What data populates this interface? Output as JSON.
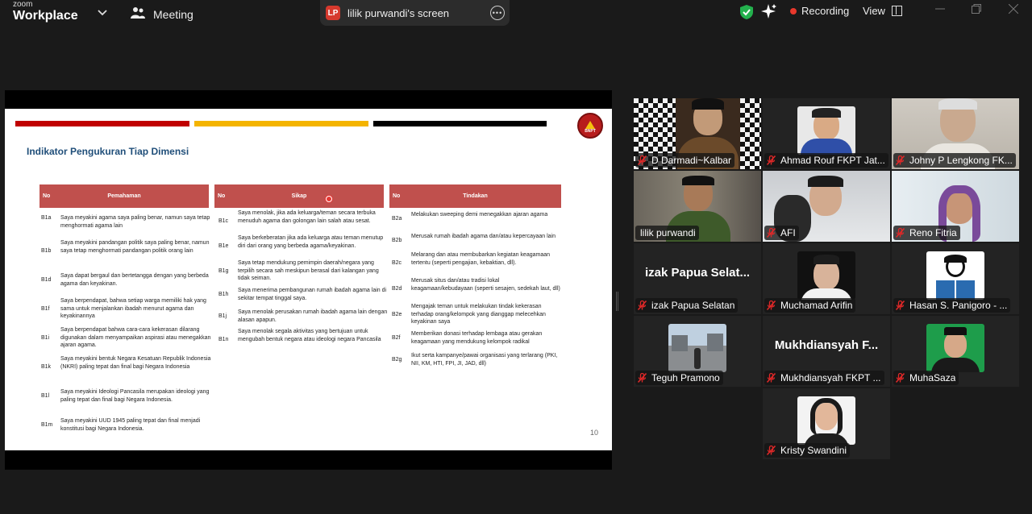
{
  "app": {
    "brand_top": "zoom",
    "brand_name": "Workplace",
    "meeting_label": "Meeting",
    "share_initials": "LP",
    "share_title": "lilik purwandi's screen",
    "recording_label": "Recording",
    "view_label": "View",
    "icons": [
      "chevron-down-icon",
      "people-icon",
      "more-icon",
      "shield-check-icon",
      "sparkle-icon",
      "view-grid-icon",
      "minimize-icon",
      "restore-icon",
      "close-icon"
    ]
  },
  "slide": {
    "title": "Indikator Pengukuran Tiap Dimensi",
    "logo_text": "BNPT",
    "page_number": "10",
    "colors": {
      "stripe1": "#c00000",
      "stripe2": "#f4b400",
      "stripe3": "#000000",
      "header": "#c0504d",
      "title": "#1f4e79"
    },
    "columns": [
      {
        "no_label": "No",
        "heading": "Pemahaman",
        "rows": [
          {
            "code": "B1a",
            "text": "Saya meyakini agama saya paling benar, namun saya tetap menghormati agama lain"
          },
          {
            "code": "B1b",
            "text": "Saya meyakini pandangan politik saya paling benar, namun saya tetap menghormati pandangan politik orang lain"
          },
          {
            "code": "B1d",
            "text": "Saya dapat bergaul dan bertetangga dengan yang berbeda agama dan keyakinan."
          },
          {
            "code": "B1f",
            "text": "Saya berpendapat, bahwa setiap warga memiliki hak yang sama untuk menjalankan ibadah menurut agama dan keyakinannya"
          },
          {
            "code": "B1i",
            "text": "Saya berpendapat bahwa cara-cara kekerasan dilarang digunakan dalam menyampaikan aspirasi atau menegakkan ajaran agama."
          },
          {
            "code": "B1k",
            "text": "Saya meyakini bentuk Negara Kesatuan Republik Indonesia (NKRI) paling tepat dan final bagi Negara Indonesia"
          },
          {
            "code": "B1l",
            "text": "Saya meyakini Ideologi Pancasila merupakan ideologi yang paling tepat dan final bagi Negara Indonesia."
          },
          {
            "code": "B1m",
            "text": "Saya meyakini UUD 1945 paling tepat dan final menjadi konstitusi bagi Negara Indonesia."
          }
        ]
      },
      {
        "no_label": "No",
        "heading": "Sikap",
        "rows": [
          {
            "code": "B1c",
            "text": "Saya menolak, jika ada keluarga/teman secara terbuka menuduh agama dan golongan lain salah atau sesat."
          },
          {
            "code": "B1e",
            "text": "Saya berkeberatan jika ada keluarga atau teman menutup diri dari orang yang berbeda agama/keyakinan."
          },
          {
            "code": "B1g",
            "text": "Saya tetap mendukung pemimpin daerah/negara yang terpilih secara sah meskipun berasal dari kalangan yang tidak seiman."
          },
          {
            "code": "B1h",
            "text": "Saya menerima pembangunan rumah ibadah agama lain di sekitar tempat tinggal saya."
          },
          {
            "code": "B1j",
            "text": "Saya menolak perusakan rumah ibadah agama lain dengan alasan apapun."
          },
          {
            "code": "B1n",
            "text": "Saya menolak segala aktivitas yang bertujuan untuk mengubah bentuk negara atau ideologi negara Pancasila"
          }
        ]
      },
      {
        "no_label": "No",
        "heading": "Tindakan",
        "rows": [
          {
            "code": "B2a",
            "text": "Melakukan sweeping demi menegakkan ajaran agama"
          },
          {
            "code": "B2b",
            "text": "Merusak rumah ibadah agama dan/atau kepercayaan lain"
          },
          {
            "code": "B2c",
            "text": "Melarang dan atau membubarkan kegiatan keagamaan tertentu (seperti pengajian, kebaktian, dll)."
          },
          {
            "code": "B2d",
            "text": "Merusak situs dan/atau tradisi lokal keagamaan/kebudayaan (seperti sesajen, sedekah laut, dll)"
          },
          {
            "code": "B2e",
            "text": "Mengajak teman untuk melakukan tindak kekerasan terhadap orang/kelompok yang dianggap melecehkan keyakinan saya"
          },
          {
            "code": "B2f",
            "text": "Memberikan donasi terhadap lembaga atau gerakan keagamaan yang mendukung kelompok radikal"
          },
          {
            "code": "B2g",
            "text": "Ikut serta kampanye/pawai organisasi yang terlarang (PKI, NII, KM, HTI, FPI, JI, JAD, dll)"
          }
        ]
      }
    ]
  },
  "participants": [
    {
      "name": "D Darmadi~Kalbar"
    },
    {
      "name": "Ahmad Rouf FKPT Jat..."
    },
    {
      "name": "Johny P Lengkong FK..."
    },
    {
      "name": "lilik purwandi"
    },
    {
      "name": "AFI"
    },
    {
      "name": "Reno Fitria"
    },
    {
      "name": "izak Papua Selatan",
      "big_name": "izak Papua Selat..."
    },
    {
      "name": "Muchamad Arifin"
    },
    {
      "name": "Hasan S. Panigoro - ..."
    },
    {
      "name": "Teguh Pramono"
    },
    {
      "name": "Mukhdiansyah FKPT ...",
      "big_name": "Mukhdiansyah F..."
    },
    {
      "name": "MuhaSaza"
    },
    {
      "name": "Kristy Swandini"
    }
  ]
}
